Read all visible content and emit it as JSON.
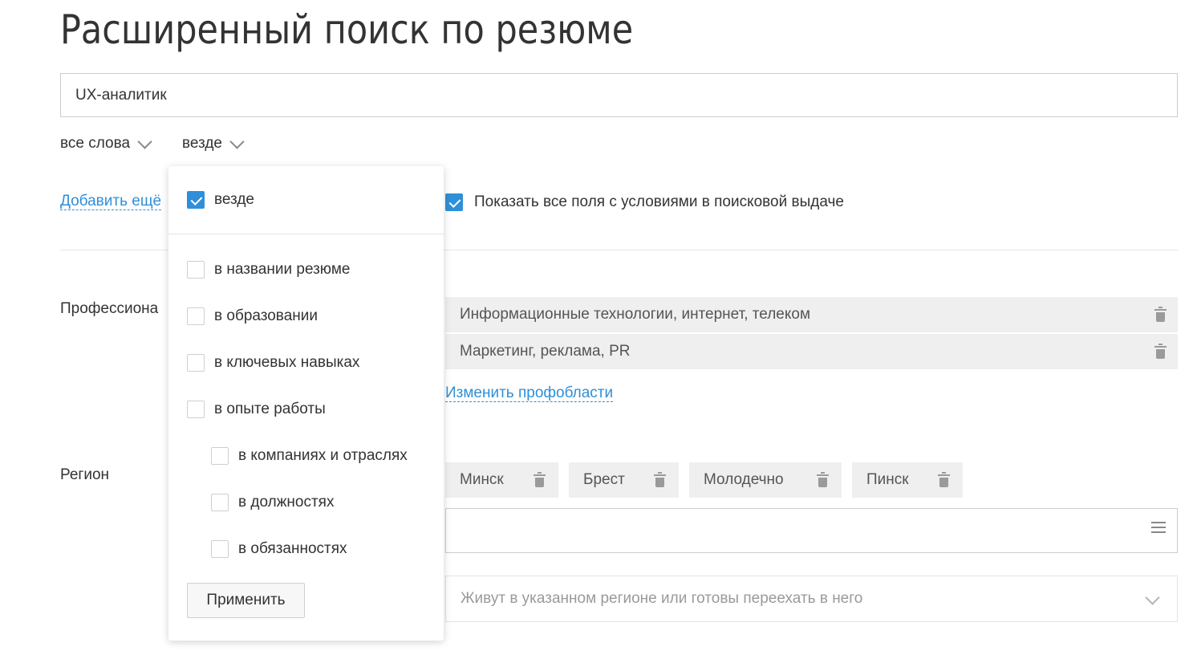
{
  "page": {
    "title": "Расширенный поиск по резюме"
  },
  "search": {
    "value": "UX-аналитик"
  },
  "filters": {
    "words_mode": "все слова",
    "scope": "везде"
  },
  "add_more": {
    "label": "Добавить ещё"
  },
  "show_all_fields": {
    "label": "Показать все поля с условиями в поисковой выдаче",
    "checked": true
  },
  "professional_area": {
    "label": "Профессиона",
    "items": [
      "Информационные технологии, интернет, телеком",
      "Маркетинг, реклама, PR"
    ],
    "change_link": "Изменить профобласти"
  },
  "region": {
    "label": "Регион",
    "chips": [
      "Минск",
      "Брест",
      "Молодечно",
      "Пинск"
    ],
    "relocation": "Живут в указанном регионе или готовы переехать в него"
  },
  "scope_dropdown": {
    "options": [
      {
        "label": "везде",
        "checked": true
      },
      {
        "label": "в названии резюме",
        "checked": false
      },
      {
        "label": "в образовании",
        "checked": false
      },
      {
        "label": "в ключевых навыках",
        "checked": false
      },
      {
        "label": "в опыте работы",
        "checked": false
      },
      {
        "label": "в компаниях и отраслях",
        "checked": false
      },
      {
        "label": "в должностях",
        "checked": false
      },
      {
        "label": "в обязанностях",
        "checked": false
      }
    ],
    "apply_label": "Применить"
  },
  "colors": {
    "accent": "#2f8fd8",
    "chip_bg": "#efefef"
  },
  "icons": {
    "chip_remove": "trash-icon",
    "region_list": "list-icon",
    "dropdown": "chevron-down-icon"
  }
}
